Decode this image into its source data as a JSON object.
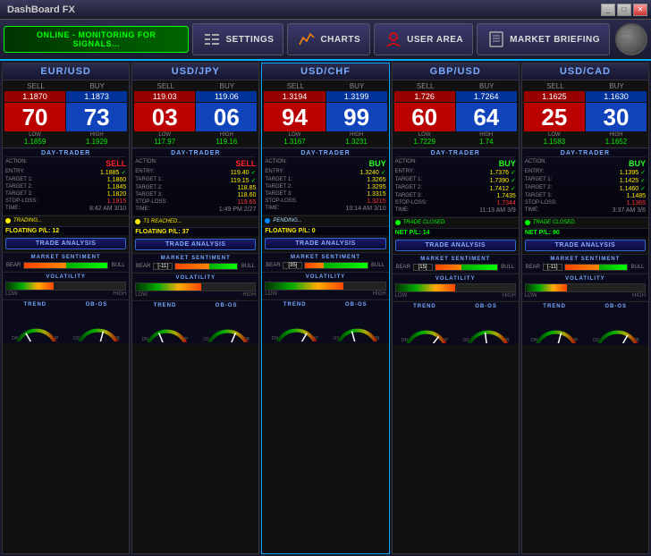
{
  "app": {
    "title": "DashBoard FX",
    "title_controls": [
      "_",
      "□",
      "✕"
    ]
  },
  "nav": {
    "online_text": "ONLINE - MONITORING FOR SIGNALS...",
    "settings_label": "SETTINGS",
    "charts_label": "CHARTS",
    "user_area_label": "USER AREA",
    "market_briefing_label": "MARKET BRIEFING"
  },
  "columns": [
    {
      "id": "eurusd",
      "pair": "EUR/USD",
      "highlighted": false,
      "sell_price": "1.1870",
      "buy_price": "1.1873",
      "sell_big": "70",
      "buy_big": "73",
      "low": "1.1859",
      "high": "1.1929",
      "action": "SELL",
      "action_type": "sell",
      "entry": "1.1885",
      "target1": "1.1860",
      "target2": "1.1845",
      "target3": "1.1820",
      "stoploss": "1.1915",
      "time": "8:42 AM 3/10",
      "status_type": "trading",
      "status_text": "TRADING...",
      "pl_type": "floating",
      "pl_label": "FLOATING P/L:",
      "pl_value": "12",
      "sentiment_bear": 50,
      "sentiment_bull": 50,
      "sentiment_value": "",
      "volatility": 40,
      "trend_needle": -20,
      "obos_needle": 10
    },
    {
      "id": "usdjpy",
      "pair": "USD/JPY",
      "highlighted": false,
      "sell_price": "119.03",
      "buy_price": "119.06",
      "sell_big": "03",
      "buy_big": "06",
      "low": "117.97",
      "high": "119.16",
      "action": "SELL",
      "action_type": "sell",
      "entry": "119.40",
      "target1": "119.15",
      "target2": "118.85",
      "target3": "118.60",
      "stoploss": "119.65",
      "time": "1:49 PM 2/27",
      "status_type": "t1reached",
      "status_text": "T1 REACHED...",
      "pl_type": "floating",
      "pl_label": "FLOATING P/L:",
      "pl_value": "37",
      "sentiment_bear": 55,
      "sentiment_bull": 45,
      "sentiment_value": "-11",
      "volatility": 55,
      "trend_needle": -15,
      "obos_needle": 15
    },
    {
      "id": "usdchf",
      "pair": "USD/CHF",
      "highlighted": true,
      "sell_price": "1.3194",
      "buy_price": "1.3199",
      "sell_big": "94",
      "buy_big": "99",
      "low": "1.3167",
      "high": "1.3231",
      "action": "BUY",
      "action_type": "buy",
      "entry": "1.3240",
      "target1": "1.3265",
      "target2": "1.3295",
      "target3": "1.3315",
      "stoploss": "1.3215",
      "time": "10:14 AM 3/10",
      "status_type": "pending",
      "status_text": "PENDING...",
      "pl_type": "floating",
      "pl_label": "FLOATING P/L:",
      "pl_value": "0",
      "sentiment_bear": 30,
      "sentiment_bull": 70,
      "sentiment_value": "35",
      "volatility": 65,
      "trend_needle": 20,
      "obos_needle": -10
    },
    {
      "id": "gbpusd",
      "pair": "GBP/USD",
      "highlighted": false,
      "sell_price": "1.726",
      "buy_price": "1.7264",
      "sell_big": "60",
      "buy_big": "64",
      "low": "1.7229",
      "high": "1.74",
      "action": "BUY",
      "action_type": "buy",
      "entry": "1.7376",
      "target1": "1.7390",
      "target2": "1.7412",
      "target3": "1.7435",
      "stoploss": "1.7344",
      "time": "11:13 AM 3/9",
      "status_type": "closed",
      "status_text": "TRADE CLOSED.",
      "pl_type": "net",
      "pl_label": "NET P/L:",
      "pl_value": "14",
      "sentiment_bear": 42,
      "sentiment_bull": 58,
      "sentiment_value": "15",
      "volatility": 50,
      "trend_needle": 25,
      "obos_needle": -5
    },
    {
      "id": "usdcad",
      "pair": "USD/CAD",
      "highlighted": false,
      "sell_price": "1.1625",
      "buy_price": "1.1630",
      "sell_big": "25",
      "buy_big": "30",
      "low": "1.1583",
      "high": "1.1652",
      "action": "BUY",
      "action_type": "buy",
      "entry": "1.1395",
      "target1": "1.1425",
      "target2": "1.1460",
      "target3": "1.1485",
      "stoploss": "1.1365",
      "time": "3:37 AM 3/6",
      "status_type": "closed",
      "status_text": "TRADE CLOSED.",
      "pl_type": "net",
      "pl_label": "NET P/L:",
      "pl_value": "90",
      "sentiment_bear": 55,
      "sentiment_bull": 45,
      "sentiment_value": "-11",
      "volatility": 35,
      "trend_needle": 10,
      "obos_needle": 20
    }
  ]
}
